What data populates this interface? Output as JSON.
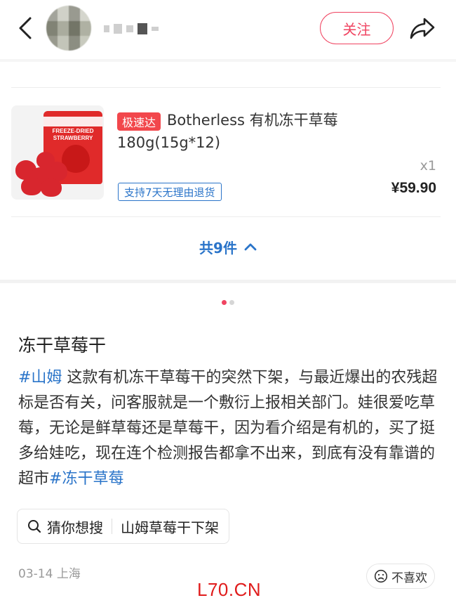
{
  "header": {
    "follow_label": "关注",
    "icons": {
      "back": "chevron-left-icon",
      "share": "share-arrow-icon"
    }
  },
  "product": {
    "fast_badge": "极速达",
    "title": "Botherless 有机冻干草莓",
    "spec": "180g(15g*12)",
    "return_tag": "支持7天无理由退货",
    "quantity": "x1",
    "price": "¥59.90",
    "package_text": "FREEZE-DRIED STRAWBERRY"
  },
  "order": {
    "total_label": "共9件"
  },
  "carousel": {
    "current": 1,
    "total": 2
  },
  "post": {
    "title": "冻干草莓干",
    "hashtag1": "#山姆",
    "body": " 这款有机冻干草莓干的突然下架，与最近爆出的农残超标是否有关，问客服就是一个敷衍上报相关部门。娃很爱吃草莓，无论是鲜草莓还是草莓干，因为看介绍是有机的，买了挺多给娃吃，现在连个检测报告都拿不出来，到底有没有靠谱的超市",
    "hashtag2": "#冻干草莓"
  },
  "guess": {
    "label": "猜你想搜",
    "query": "山姆草莓干下架"
  },
  "meta": {
    "date": "03-14",
    "location": "上海"
  },
  "dislike_label": "不喜欢",
  "watermark": "L70.CN",
  "colors": {
    "accent_red": "#f04461",
    "link_blue": "#2a74c9",
    "badge_red": "#f2474c"
  }
}
